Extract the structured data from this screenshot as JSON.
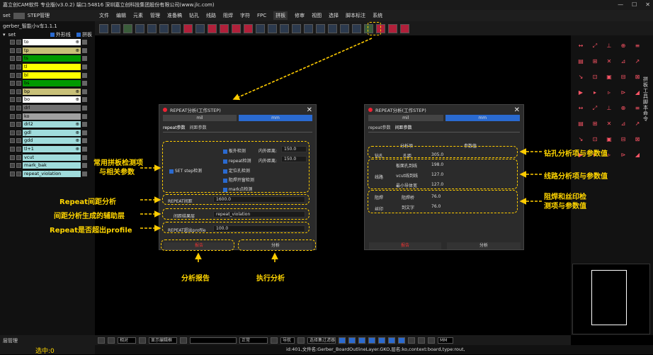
{
  "title": "嘉立创CAM软件 专业版(v3.0.2) 端口:54816    深圳嘉立创科技集团股份有限公司(www.jlc.com)",
  "window_controls": [
    "—",
    "☐",
    "✕"
  ],
  "left": {
    "tab1": "set",
    "tab2": "STEP管理",
    "job": "gerber_智能小v车1.1.1",
    "set_label": "set",
    "chk1": "外形线",
    "chk2": "拼板",
    "layers": [
      {
        "n": "to",
        "c": "#ffffff",
        "i": "⊕"
      },
      {
        "n": "tp",
        "c": "#c8c078",
        "i": "⊕"
      },
      {
        "n": "ts",
        "c": "#009900",
        "i": ""
      },
      {
        "n": "tl",
        "c": "#ffff00",
        "i": ""
      },
      {
        "n": "bl",
        "c": "#ffff00",
        "i": ""
      },
      {
        "n": "bs",
        "c": "#009900",
        "i": ""
      },
      {
        "n": "bp",
        "c": "#c8c078",
        "i": "⊕"
      },
      {
        "n": "bo",
        "c": "#ffffff",
        "i": "⊕"
      },
      {
        "n": "drl",
        "c": "#707070",
        "i": ""
      },
      {
        "n": "ko",
        "c": "#a0a0a0",
        "i": ""
      },
      {
        "n": "drl2",
        "c": "#a0dcdc",
        "i": "⊕"
      },
      {
        "n": "gdl",
        "c": "#a0dcdc",
        "i": "⊕"
      },
      {
        "n": "gdd",
        "c": "#a0dcdc",
        "i": "⊕"
      },
      {
        "n": "tl+1",
        "c": "#a0dcdc",
        "i": "⊕"
      },
      {
        "n": "vcut",
        "c": "#a0dcdc",
        "i": ""
      },
      {
        "n": "mark_bak",
        "c": "#a0dcdc",
        "i": ""
      },
      {
        "n": "repeat_violation",
        "c": "#a0dcdc",
        "i": ""
      }
    ],
    "bottom_tab": "层管理",
    "selected": "选中:0"
  },
  "menu": [
    "文件",
    "编辑",
    "元素",
    "管理",
    "准备稿",
    "钻孔",
    "线路",
    "阻焊",
    "字符",
    "FPC",
    "拼板",
    "修审",
    "视图",
    "选择",
    "脚本标注",
    "系统"
  ],
  "menu_active": "拼板",
  "toolbar_count": 26,
  "right_labels": "拼板工具 脚本命令",
  "dialog1": {
    "title": "REPEAT分析(工作STEP)",
    "unit_mil": "mil",
    "unit_mm": "mm",
    "tab1": "repeat参数",
    "tab2": "间距参数",
    "set_step": "SET step检测",
    "c1": "板外检测",
    "c2": "repeat检测",
    "c3": "定位孔检测",
    "c4": "阻焊开窗检测",
    "c5": "mark点检测",
    "lbl_inner": "内外距离:",
    "v1": "150.0",
    "lbl_inner2": "内外距离:",
    "v2": "150.0",
    "repeat_gap_label": "REPEAT间距",
    "repeat_gap": "1600.0",
    "gap_layer_label": "间距结果层",
    "gap_layer": "repeat_violation",
    "profile_label": "REPEAT超出profile",
    "profile_val": "100.0",
    "btn_report": "报告",
    "btn_analyze": "分析"
  },
  "dialog2": {
    "title": "REPEAT分析(工作STEP)",
    "unit_mil": "mil",
    "unit_mm": "mm",
    "tab1": "repeat参数",
    "tab2": "间距参数",
    "hdr1": "分析项",
    "hdr2": "参数值",
    "sec_drill": "钻孔",
    "drill_item": "孔距",
    "drill_val": "305.0",
    "sec_line": "线路",
    "l1": "板面孔到线",
    "l1v": "198.0",
    "l2": "vcut线到线",
    "l2v": "127.0",
    "l3": "最小导体宽",
    "l3v": "127.0",
    "sec_mask": "阻焊",
    "m1": "阻焊桥",
    "m1v": "76.0",
    "sec_silk": "丝印",
    "s1": "到文字",
    "s1v": "76.0",
    "btn_report": "报告",
    "btn_analyze": "分析"
  },
  "ann": {
    "a1": "常用拼板检测项\n与相关参数",
    "a2": "Repeat间距分析",
    "a3": "间距分析生成的辅助层",
    "a4": "Repeat是否超出profile",
    "a5": "分析报告",
    "a6": "执行分析",
    "a7": "钻孔分析项与参数值",
    "a8": "线路分析项与参数值",
    "a9": "阻焊和丝印检\n测项与参数值"
  },
  "bottom": {
    "zoom": "相对",
    "show": "显示编辑框",
    "mode": "正常",
    "nav": "导航",
    "filter": "选择集过滤器",
    "unit": "MM"
  },
  "status": "id:401,文件名:Gerber_BoardOutlineLayer.GKO,层名:ko,context:board,type:rout,"
}
